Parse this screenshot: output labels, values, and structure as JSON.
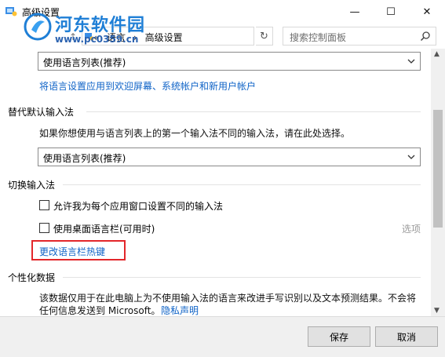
{
  "window": {
    "title": "高级设置",
    "minimize": "—",
    "maximize": "☐",
    "close": "✕"
  },
  "watermark": {
    "name": "河东软件园",
    "url": "www.pc0359.cn"
  },
  "address": {
    "up": "↑",
    "crumb_sep": "«",
    "crumbs": [
      "语言",
      "高级设置"
    ],
    "dropdown": "⌄",
    "refresh": "↻",
    "search_placeholder": "搜索控制面板"
  },
  "content": {
    "display_language_dropdown": "使用语言列表(推荐)",
    "apply_link": "将语言设置应用到欢迎屏幕、系统帐户和新用户帐户",
    "default_input": {
      "title": "替代默认输入法",
      "description": "如果你想使用与语言列表上的第一个输入法不同的输入法，请在此处选择。",
      "dropdown": "使用语言列表(推荐)"
    },
    "switch_input": {
      "title": "切换输入法",
      "checkbox1": "允许我为每个应用窗口设置不同的输入法",
      "checkbox2": "使用桌面语言栏(可用时)",
      "options_link": "选项",
      "hotkey_link": "更改语言栏热键"
    },
    "personalization": {
      "title": "个性化数据",
      "line1": "该数据仅用于在此电脑上为不使用输入法的语言来改进手写识别以及文本预测结果。不会将",
      "line2_prefix": "任何信息发送到 Microsoft。",
      "privacy_link": "隐私声明"
    }
  },
  "footer": {
    "save": "保存",
    "cancel": "取消"
  },
  "colors": {
    "link": "#0f63c7",
    "highlight": "#e3262a",
    "watermark": "#1f7fd6"
  }
}
